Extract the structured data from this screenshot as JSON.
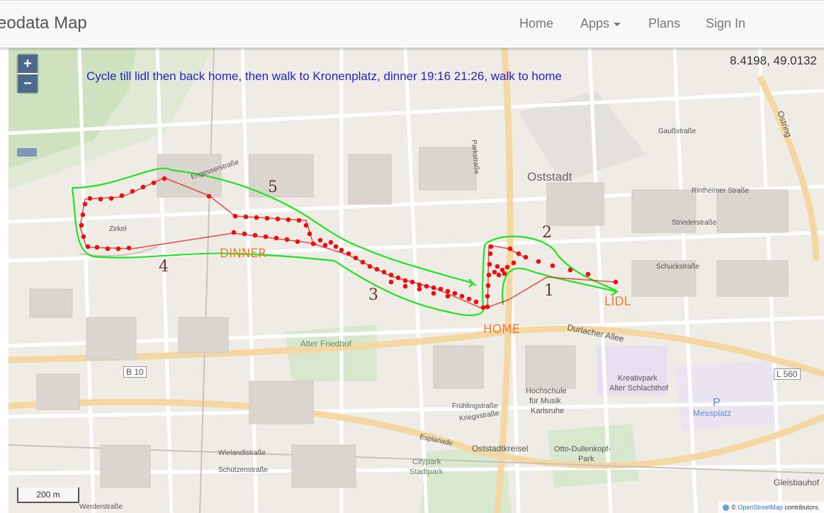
{
  "brand": "eodata Map",
  "nav": {
    "home": "Home",
    "apps": "Apps",
    "plans": "Plans",
    "signin": "Sign In"
  },
  "map": {
    "coords": "8.4198, 49.0132",
    "description": "Cycle till lidl then back home, then walk to Kronenplatz, dinner 19:16 21:26, walk to home",
    "zoom_in": "+",
    "zoom_out": "−",
    "scale": "200 m",
    "attribution_prefix": "©",
    "attribution_link": "OpenStreetMap",
    "attribution_suffix": "contributors.",
    "labels": {
      "dinner": "DINNER",
      "home": "HOME",
      "lidl": "LIDL",
      "n1": "1",
      "n2": "2",
      "n3": "3",
      "n4": "4",
      "n5": "5"
    },
    "streets": [
      "Oststadt",
      "Alter Friedhof",
      "Durlacher Allee",
      "Messplatz",
      "Hochschule",
      "für Musik",
      "Karlsruhe",
      "Kreativpark",
      "Alter Schlachthof",
      "Oststadtkreisel",
      "Otto-Dullenkopf-",
      "Park",
      "Citypark",
      "Stadtpark",
      "Gleisbauhof",
      "Ostring",
      "B 10",
      "L 560",
      "Esplanade",
      "Gaußstraße",
      "Rintheimer Straße",
      "Striederstraße",
      "Schuckstraße",
      "Engesserstraße",
      "Zirkel",
      "Parkstraße",
      "Kriegsstraße",
      "Frühlingstraße",
      "Wielandtstraße",
      "Schützenstraße",
      "Werderstraße",
      "P"
    ],
    "colors": {
      "track": "#e81010",
      "outline": "#22e122",
      "label": "#ee7c30",
      "number": "#6b2e2a",
      "description": "#2222cc"
    }
  }
}
